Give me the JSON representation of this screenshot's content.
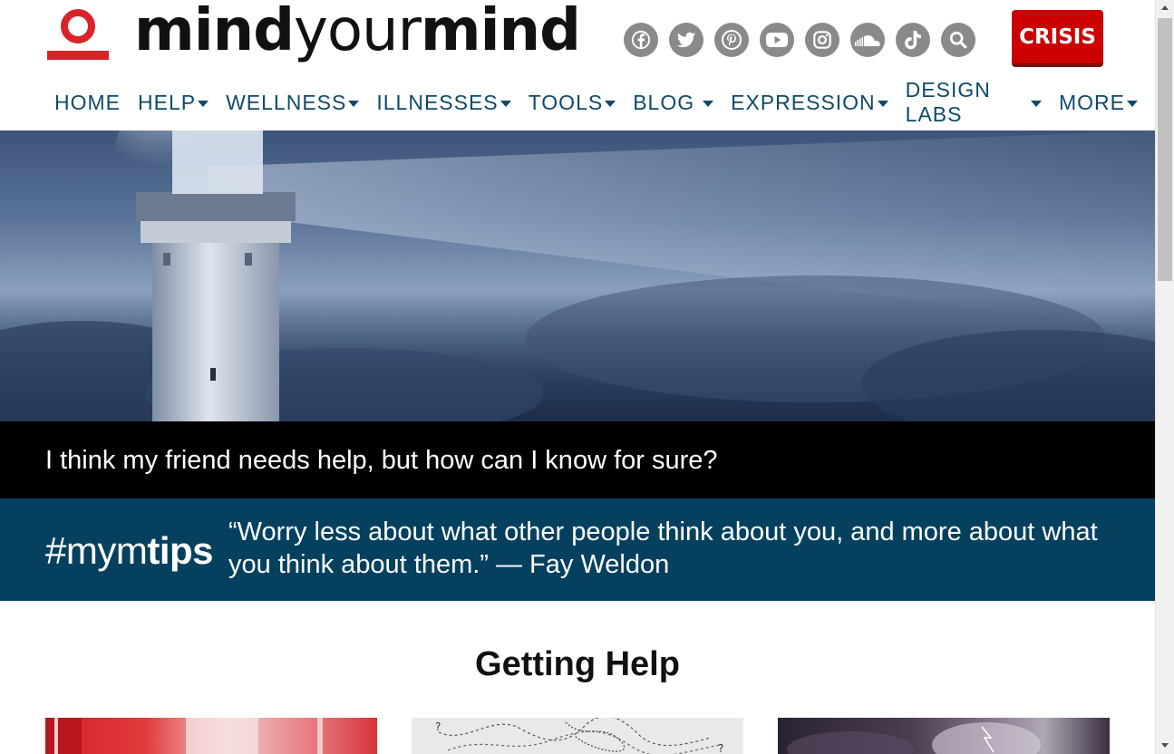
{
  "brand": {
    "logo_bold_1": "mind",
    "logo_thin": "your",
    "logo_bold_2": "mind",
    "logo_color": "#d8232a"
  },
  "social_icons": [
    {
      "name": "facebook-icon"
    },
    {
      "name": "twitter-icon"
    },
    {
      "name": "pinterest-icon"
    },
    {
      "name": "youtube-icon"
    },
    {
      "name": "instagram-icon"
    },
    {
      "name": "soundcloud-icon"
    },
    {
      "name": "tiktok-icon"
    },
    {
      "name": "search-icon"
    }
  ],
  "crisis_button": {
    "label": "CRISIS",
    "color": "#cc0000"
  },
  "nav": {
    "items": [
      {
        "label": "HOME",
        "dropdown": false
      },
      {
        "label": "HELP",
        "dropdown": true
      },
      {
        "label": "WELLNESS",
        "dropdown": true
      },
      {
        "label": "ILLNESSES",
        "dropdown": true
      },
      {
        "label": "TOOLS",
        "dropdown": true
      },
      {
        "label": "BLOG",
        "dropdown": true
      },
      {
        "label": "EXPRESSION",
        "dropdown": true
      },
      {
        "label": "DESIGN LABS",
        "dropdown": true
      },
      {
        "label": "MORE",
        "dropdown": true
      }
    ],
    "color": "#0d4a6b"
  },
  "hero": {
    "caption": "I think my friend needs help, but how can I know for sure?"
  },
  "tips": {
    "hashtag_prefix": "#mym",
    "hashtag_bold": "tips",
    "quote": "“Worry less about what other people think about you, and more about what you think about them.” — Fay Weldon",
    "background": "#05415f"
  },
  "section": {
    "title_regular": "Getting ",
    "title_bold": "Help"
  }
}
